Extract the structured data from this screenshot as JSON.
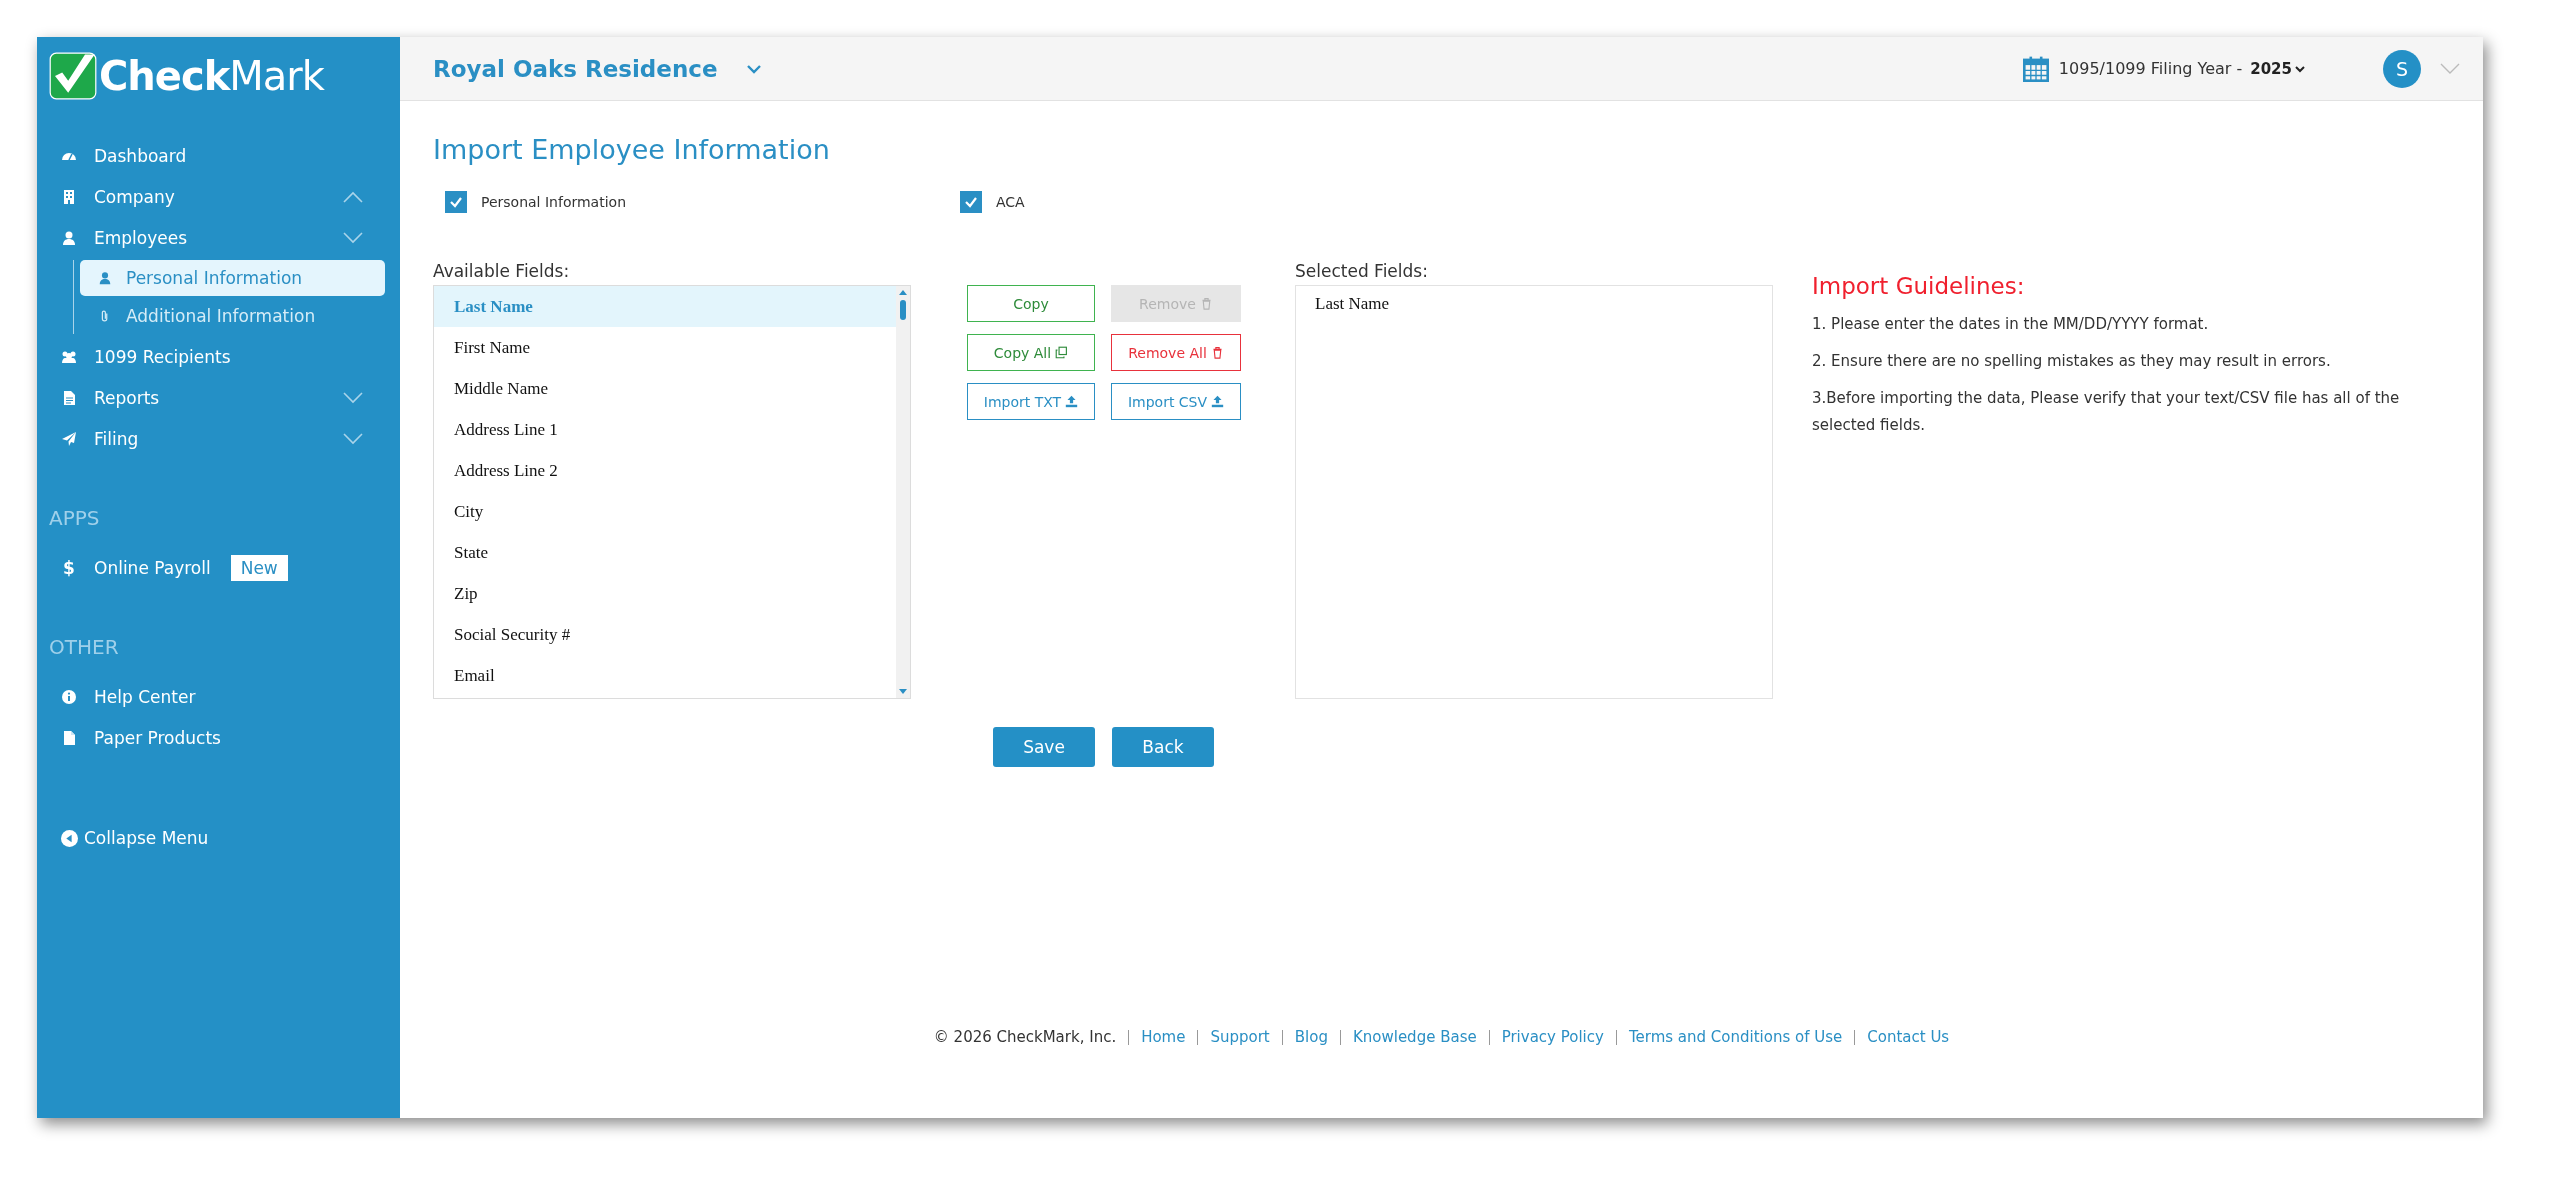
{
  "logo": {
    "bold": "Check",
    "light": "Mark"
  },
  "sidebar": {
    "items": [
      {
        "label": "Dashboard"
      },
      {
        "label": "Company",
        "expanded": true
      },
      {
        "label": "Employees",
        "expanded": false,
        "children": [
          {
            "label": "Personal Information",
            "selected": true
          },
          {
            "label": "Additional Information",
            "selected": false
          }
        ]
      },
      {
        "label": "1099 Recipients"
      },
      {
        "label": "Reports",
        "expanded": false
      },
      {
        "label": "Filing",
        "expanded": false
      }
    ],
    "sections": [
      {
        "heading": "APPS",
        "items": [
          {
            "symbol": "$",
            "label": "Online Payroll",
            "badge": "New"
          }
        ]
      },
      {
        "heading": "OTHER",
        "items": [
          {
            "label": "Help Center"
          },
          {
            "label": "Paper Products"
          }
        ]
      }
    ],
    "collapse": "Collapse Menu"
  },
  "header": {
    "company": "Royal Oaks Residence",
    "filing_year_label": "1095/1099 Filing Year -",
    "year": "2025",
    "avatar": "S"
  },
  "page": {
    "title": "Import Employee Information",
    "checkboxes": [
      {
        "label": "Personal Information",
        "checked": true
      },
      {
        "label": "ACA",
        "checked": true
      }
    ],
    "available": {
      "label": "Available Fields:",
      "items": [
        {
          "label": "Last Name",
          "selected": true
        },
        {
          "label": "First Name",
          "selected": false
        },
        {
          "label": "Middle Name",
          "selected": false
        },
        {
          "label": "Address Line 1",
          "selected": false
        },
        {
          "label": "Address Line 2",
          "selected": false
        },
        {
          "label": "City",
          "selected": false
        },
        {
          "label": "State",
          "selected": false
        },
        {
          "label": "Zip",
          "selected": false
        },
        {
          "label": "Social Security #",
          "selected": false
        },
        {
          "label": "Email",
          "selected": false
        }
      ]
    },
    "buttons": [
      {
        "label": "Copy",
        "kind": "success",
        "disabled": false
      },
      {
        "label": "Remove",
        "kind": "danger",
        "disabled": true
      },
      {
        "label": "Copy All",
        "kind": "success",
        "disabled": false
      },
      {
        "label": "Remove All",
        "kind": "danger",
        "disabled": false
      },
      {
        "label": "Import TXT",
        "kind": "info",
        "disabled": false
      },
      {
        "label": "Import CSV",
        "kind": "info",
        "disabled": false
      }
    ],
    "selected": {
      "label": "Selected Fields:",
      "items": [
        "Last Name"
      ]
    },
    "guidelines": {
      "title": "Import Guidelines:",
      "items": [
        "1. Please enter the dates in the MM/DD/YYYY format.",
        "2. Ensure there are no spelling mistakes as they may result in errors.",
        "3.Before importing the data, Please verify that your text/CSV file has all of the selected fields."
      ]
    },
    "actions": [
      "Save",
      "Back"
    ]
  },
  "footer": {
    "copyright": "© 2026 CheckMark, Inc.",
    "links": [
      "Home",
      "Support",
      "Blog",
      "Knowledge Base",
      "Privacy Policy",
      "Terms and Conditions of Use",
      "Contact Us"
    ]
  }
}
